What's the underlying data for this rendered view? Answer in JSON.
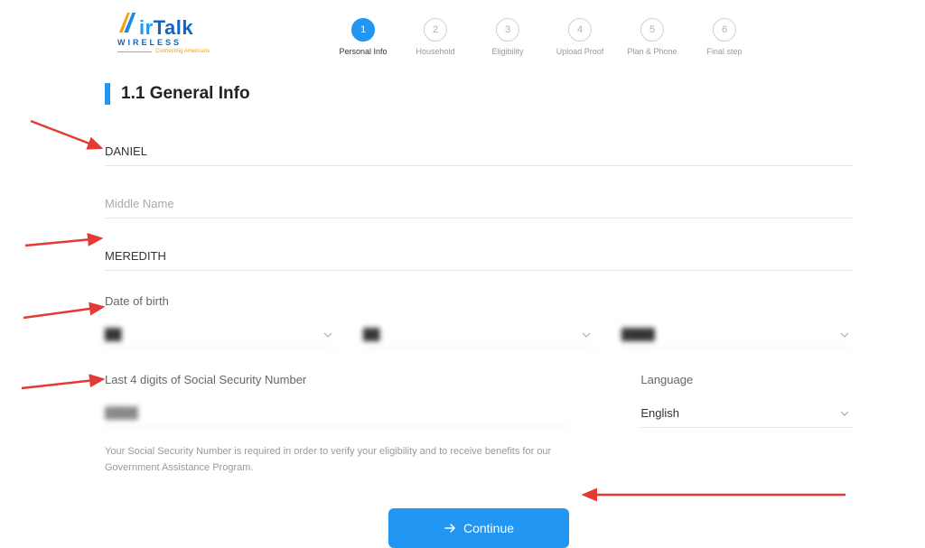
{
  "logo": {
    "brand_prefix": "ir",
    "brand_suffix": "Talk",
    "subtext": "WIRELESS",
    "tagline": "Connecting Americans"
  },
  "stepper": {
    "steps": [
      {
        "num": "1",
        "label": "Personal Info",
        "active": true
      },
      {
        "num": "2",
        "label": "Household",
        "active": false
      },
      {
        "num": "3",
        "label": "Eligibility",
        "active": false
      },
      {
        "num": "4",
        "label": "Upload Proof",
        "active": false
      },
      {
        "num": "5",
        "label": "Plan & Phone",
        "active": false
      },
      {
        "num": "6",
        "label": "Final step",
        "active": false
      }
    ]
  },
  "section": {
    "title": "1.1 General Info"
  },
  "form": {
    "first_name": "DANIEL",
    "middle_name_placeholder": "Middle Name",
    "last_name": "MEREDITH",
    "dob_label": "Date of birth",
    "dob_month": "██",
    "dob_day": "██",
    "dob_year": "████",
    "ssn_label": "Last 4 digits of Social Security Number",
    "ssn_value": "████",
    "language_label": "Language",
    "language_value": "English",
    "ssn_helper": "Your Social Security Number is required in order to verify your eligibility and to receive benefits for our Government Assistance Program."
  },
  "buttons": {
    "continue": "Continue"
  }
}
